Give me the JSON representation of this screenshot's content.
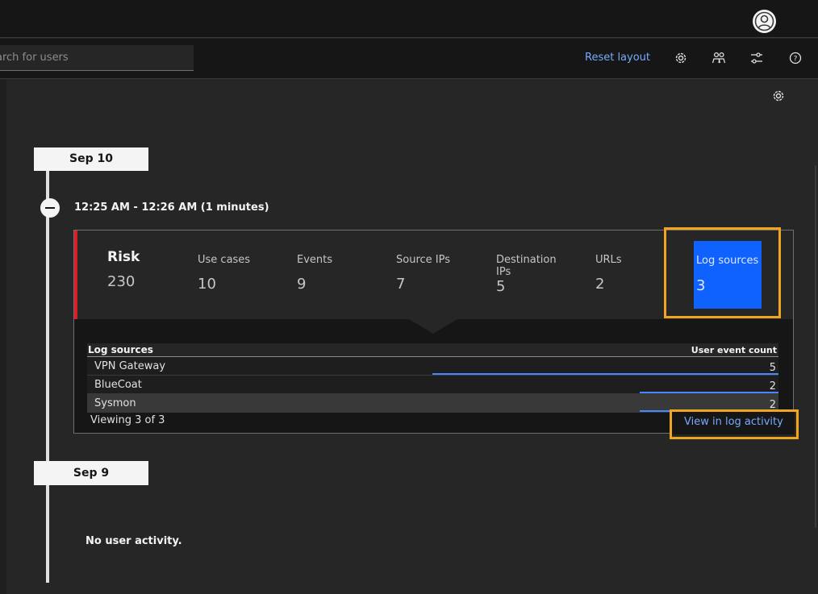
{
  "header": {
    "avatar_icon": "user-avatar-icon"
  },
  "toolbar": {
    "search_placeholder": "Search for users",
    "search_visible_text": "arch for users",
    "reset_label": "Reset layout",
    "icons": [
      "gear-icon",
      "users-icon",
      "sliders-icon",
      "help-icon"
    ]
  },
  "timeline": {
    "dates": [
      {
        "label": "Sep 10"
      },
      {
        "label": "Sep 9"
      }
    ],
    "session": {
      "time_range": "12:25 AM - 12:26 AM (1 minutes)",
      "metrics": [
        {
          "label": "Risk",
          "value": "230"
        },
        {
          "label": "Use cases",
          "value": "10"
        },
        {
          "label": "Events",
          "value": "9"
        },
        {
          "label": "Source IPs",
          "value": "7"
        },
        {
          "label": "Destination IPs",
          "value": "5"
        },
        {
          "label": "URLs",
          "value": "2"
        },
        {
          "label": "Log sources",
          "value": "3",
          "selected": true
        }
      ],
      "log_sources": {
        "col_name": "Log sources",
        "col_count": "User event count",
        "rows": [
          {
            "name": "VPN Gateway",
            "count": "5",
            "fraction": 1.0
          },
          {
            "name": "BlueCoat",
            "count": "2",
            "fraction": 0.4
          },
          {
            "name": "Sysmon",
            "count": "2",
            "fraction": 0.4
          }
        ],
        "viewing": "Viewing 3 of 3",
        "view_link": "View in log activity"
      }
    },
    "no_activity": "No user activity."
  },
  "colors": {
    "accent": "#0f62fe",
    "link": "#78a9ff",
    "risk_border": "#da1e28",
    "highlight": "#f1a51e"
  }
}
